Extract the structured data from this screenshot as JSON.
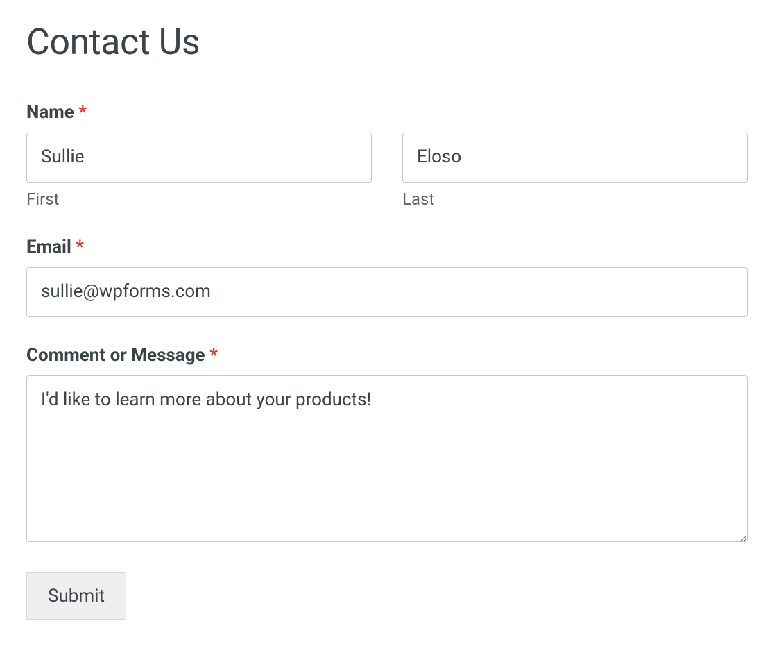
{
  "page": {
    "title": "Contact Us"
  },
  "form": {
    "name": {
      "label": "Name",
      "required_marker": "*",
      "first": {
        "value": "Sullie",
        "sublabel": "First"
      },
      "last": {
        "value": "Eloso",
        "sublabel": "Last"
      }
    },
    "email": {
      "label": "Email",
      "required_marker": "*",
      "value": "sullie@wpforms.com"
    },
    "message": {
      "label": "Comment or Message",
      "required_marker": "*",
      "value": "I'd like to learn more about your products!"
    },
    "submit": {
      "label": "Submit"
    }
  }
}
